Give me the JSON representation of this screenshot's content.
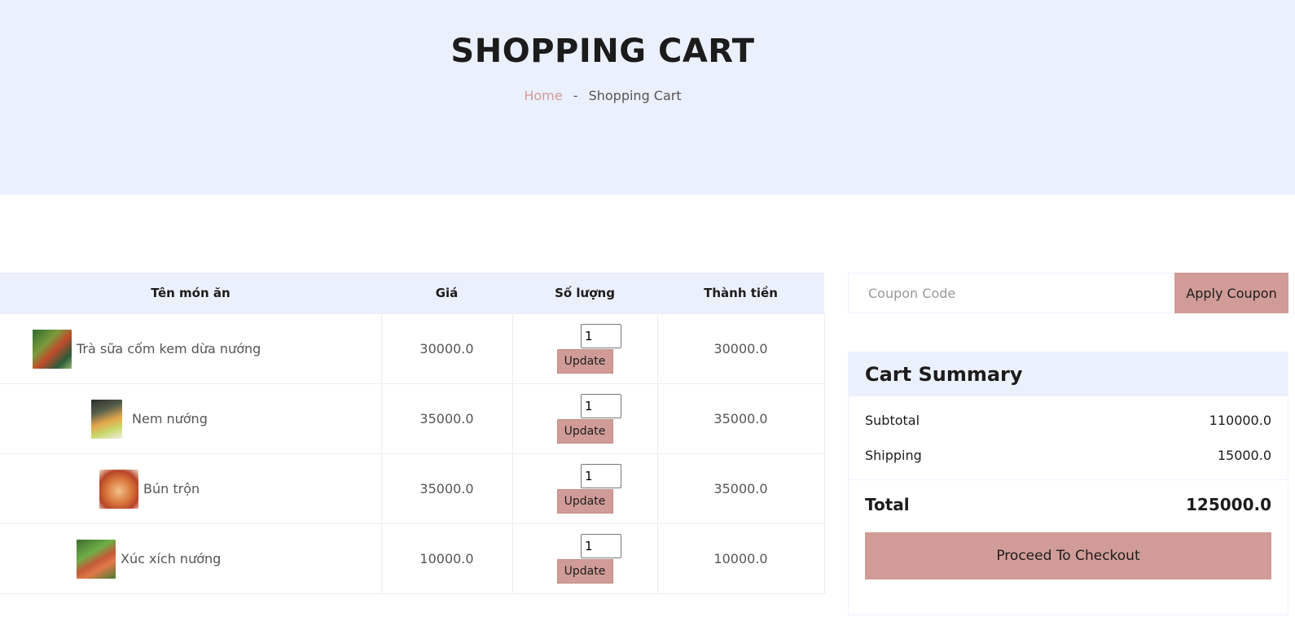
{
  "hero": {
    "title": "SHOPPING CART",
    "breadcrumb": {
      "home": "Home",
      "separator": "-",
      "current": "Shopping Cart"
    }
  },
  "cart": {
    "columns": [
      "Tên món ăn",
      "Giá",
      "Số lượng",
      "Thành tiền"
    ],
    "update_label": "Update",
    "items": [
      {
        "name": "Trà sữa cốm kem dừa nướng",
        "price": "30000.0",
        "quantity": "1",
        "total": "30000.0"
      },
      {
        "name": "Nem nướng",
        "price": "35000.0",
        "quantity": "1",
        "total": "35000.0"
      },
      {
        "name": "Bún trộn",
        "price": "35000.0",
        "quantity": "1",
        "total": "35000.0"
      },
      {
        "name": "Xúc xích nướng",
        "price": "10000.0",
        "quantity": "1",
        "total": "10000.0"
      }
    ]
  },
  "coupon": {
    "placeholder": "Coupon Code",
    "button_label": "Apply Coupon"
  },
  "summary": {
    "title": "Cart Summary",
    "subtotal_label": "Subtotal",
    "subtotal_value": "110000.0",
    "shipping_label": "Shipping",
    "shipping_value": "15000.0",
    "total_label": "Total",
    "total_value": "125000.0",
    "checkout_label": "Proceed To Checkout"
  },
  "colors": {
    "accent": "#d19c97",
    "hero_bg": "#ebf0fd",
    "text_dark": "#1c1c1c"
  }
}
